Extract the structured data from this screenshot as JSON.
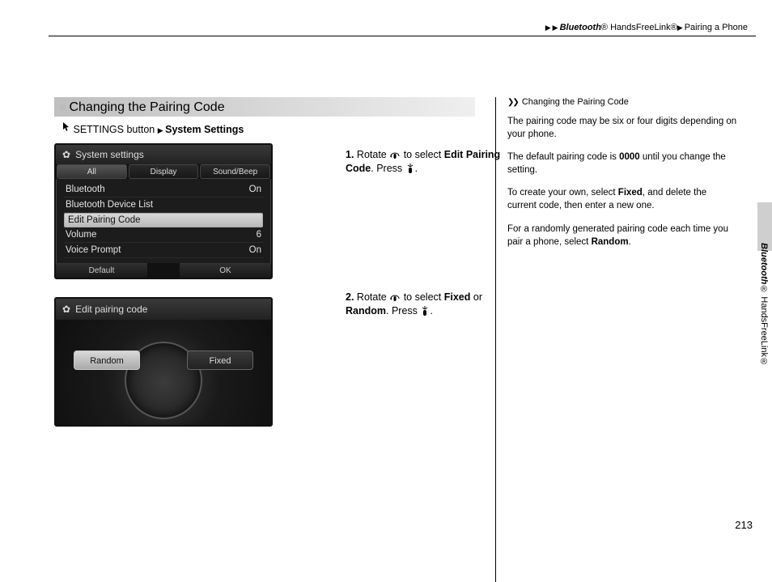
{
  "breadcrumb": {
    "part1_italic": "Bluetooth",
    "part1_rest": "® HandsFreeLink®",
    "part2": "Pairing a Phone"
  },
  "section": {
    "title": "Changing the Pairing Code",
    "nav_prefix": "SETTINGS button",
    "nav_target": "System Settings"
  },
  "screenshot1": {
    "title": "System settings",
    "tabs": [
      "All",
      "Display",
      "Sound/Beep"
    ],
    "selected_tab_index": 0,
    "rows": [
      {
        "label": "Bluetooth",
        "value": "On"
      },
      {
        "label": "Bluetooth Device List",
        "value": ""
      },
      {
        "label": "Edit Pairing Code",
        "value": ""
      },
      {
        "label": "Volume",
        "value": "6"
      },
      {
        "label": "Voice Prompt",
        "value": "On"
      }
    ],
    "selected_row_index": 2,
    "bottom_left": "Default",
    "bottom_right": "OK"
  },
  "screenshot2": {
    "title": "Edit pairing code",
    "option_left": "Random",
    "option_right": "Fixed",
    "selected": "left"
  },
  "steps": {
    "s1": {
      "num": "1.",
      "a": "Rotate ",
      "b": " to select ",
      "c": "Edit Pairing Code",
      "d": ". Press ",
      "e": "."
    },
    "s2": {
      "num": "2.",
      "a": "Rotate ",
      "b": " to select ",
      "c": "Fixed",
      "d": " or ",
      "e": "Random",
      "f": ". Press ",
      "g": "."
    }
  },
  "sidebar": {
    "heading": "Changing the Pairing Code",
    "p1": "The pairing code may be six or four digits depending on your phone.",
    "p2a": "The default pairing code is ",
    "p2b": "0000",
    "p2c": " until you change the setting.",
    "p3a": "To create your own, select ",
    "p3b": "Fixed",
    "p3c": ", and delete the current code, then enter a new one.",
    "p4a": "For a randomly generated pairing code each time you pair a phone, select ",
    "p4b": "Random",
    "p4c": "."
  },
  "edge_label": {
    "italic": "Bluetooth",
    "rest": "® HandsFreeLink®"
  },
  "page_number": "213"
}
